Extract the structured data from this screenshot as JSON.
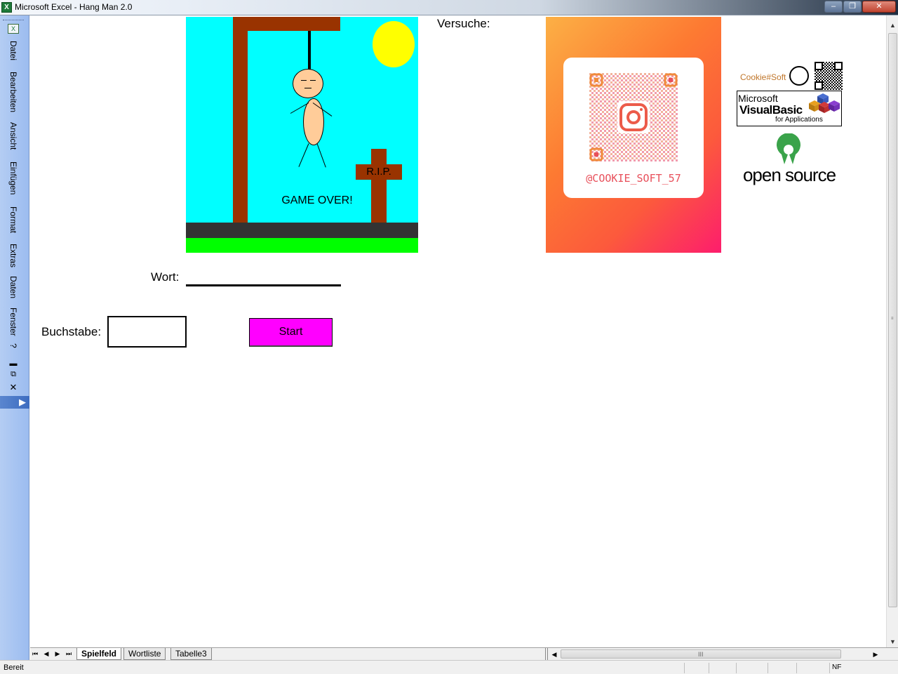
{
  "window": {
    "title": "Microsoft Excel - Hang Man 2.0",
    "app_icon_letter": "X",
    "controls": {
      "minimize": "–",
      "maximize": "❐",
      "close": "✕"
    }
  },
  "menu": {
    "items": [
      "Datei",
      "Bearbeiten",
      "Ansicht",
      "Einfügen",
      "Format",
      "Extras",
      "Daten",
      "Fenster",
      "?"
    ],
    "doc_controls": {
      "minimize": "▬",
      "restore": "⧉",
      "close": "✕"
    },
    "chevron": "▶"
  },
  "game": {
    "versuche_label": "Versuche:",
    "wort_label": "Wort:",
    "buchstabe_label": "Buchstabe:",
    "letter_value": "",
    "start_label": "Start",
    "picture": {
      "tombstone_text": "R.I.P.",
      "status_text": "GAME OVER!"
    }
  },
  "logos": {
    "instagram_handle": "@COOKIE_SOFT_57",
    "cookie_soft": "Cookie#Soft",
    "vba": {
      "line1": "Microsoft",
      "line2": "VisualBasic",
      "line3": "for Applications"
    },
    "open_source": "open source"
  },
  "sheets": {
    "nav": [
      "⏮",
      "◀",
      "▶",
      "⏭"
    ],
    "tabs": [
      "Spielfeld",
      "Wortliste",
      "Tabelle3"
    ],
    "active": "Spielfeld"
  },
  "scroll": {
    "grip": "III"
  },
  "status": {
    "text": "Bereit",
    "indicator": "NF"
  },
  "colors": {
    "sky": "#00ffff",
    "sun": "#ffff00",
    "gallows": "#993300",
    "grass": "#00ff00",
    "start_button": "#ff00ff",
    "menu_bar": "#b4cdf3"
  }
}
